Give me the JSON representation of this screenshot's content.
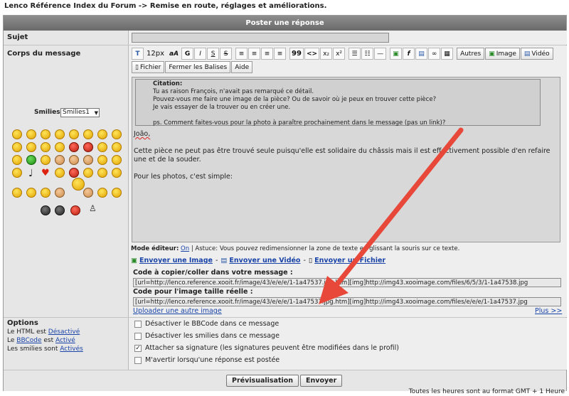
{
  "breadcrumb": "Lenco Référence Index du Forum -> Remise en route, réglages et améliorations.",
  "form_title": "Poster une réponse",
  "labels": {
    "subject": "Sujet",
    "body": "Corps du message",
    "smilies": "Smilies:",
    "options": "Options"
  },
  "smilies_select": "Smilies1",
  "subject_value": "",
  "toolbar": {
    "size": "12px",
    "bold": "G",
    "italic": "I",
    "strike": "S",
    "strike2": "S",
    "quote": "99",
    "code": "<>",
    "sub": "x₂",
    "sup": "x²",
    "autres": "Autres",
    "image": "Image",
    "video": "Vidéo",
    "fichier": "Fichier",
    "fermer": "Fermer les Balises",
    "aide": "Aide"
  },
  "editor": {
    "quote_title": "Citation:",
    "quote_lines": [
      "Tu as raison François, n'avait pas remarqué ce détail.",
      "Pouvez-vous me faire une image de la pièce? Ou de savoir où je peux en trouver cette pièce?",
      "Je vais essayer de la trouver ou en créer une.",
      "",
      "ps. Comment faites-vous pour la photo à paraître prochainement dans le message (pas un link)?"
    ],
    "greeting": "João,",
    "para1": "Cette pièce ne peut pas être trouvé seule puisqu'elle est solidaire du châssis mais il est effectivement possible d'en refaire une et de la souder.",
    "para2": "Pour les photos, c'est simple:"
  },
  "status": {
    "mode_label": "Mode éditeur:",
    "mode_value": "On",
    "hint": "| Astuce: Vous pouvez redimensionner la zone de texte en glissant la souris sur ce texte."
  },
  "upload": {
    "send_image": "Envoyer une Image",
    "send_video": "Envoyer une Vidéo",
    "send_file": "Envoyer un Fichier",
    "code_label": "Code à copier/coller dans votre message :",
    "code_value": "[url=http://lenco.reference.xooit.fr/image/43/e/e/e/1-1a47537.jpg.htm][img]http://img43.xooimage.com/files/6/5/3/1-1a47538.jpg",
    "full_label": "Code pour l'image taille réelle :",
    "full_value": "[url=http://lenco.reference.xooit.fr/image/43/e/e/e/1-1a47537.jpg.htm][img]http://img43.xooimage.com/files/e/e/e/1-1a47537.jpg",
    "upload_other": "Uploader une autre image",
    "more": "Plus >>"
  },
  "options_left": [
    {
      "prefix": "Le HTML est ",
      "link": "Désactivé"
    },
    {
      "prefix": "Le ",
      "link": "BBCode",
      "mid": " est ",
      "link2": "Activé"
    },
    {
      "prefix": "Les smilies sont ",
      "link": "Activés"
    }
  ],
  "options": [
    {
      "label": "Désactiver le BBCode dans ce message",
      "checked": false
    },
    {
      "label": "Désactiver les smilies dans ce message",
      "checked": false
    },
    {
      "label": "Attacher sa signature (les signatures peuvent être modifiées dans le profil)",
      "checked": true
    },
    {
      "label": "M'avertir lorsqu'une réponse est postée",
      "checked": false
    }
  ],
  "buttons": {
    "preview": "Prévisualisation",
    "send": "Envoyer"
  },
  "footnote": "Toutes les heures sont au format GMT + 1 Heure",
  "colors": {
    "title_bar": "#7a7a7a",
    "link": "#1a44a8",
    "arrow": "#e8483a"
  }
}
